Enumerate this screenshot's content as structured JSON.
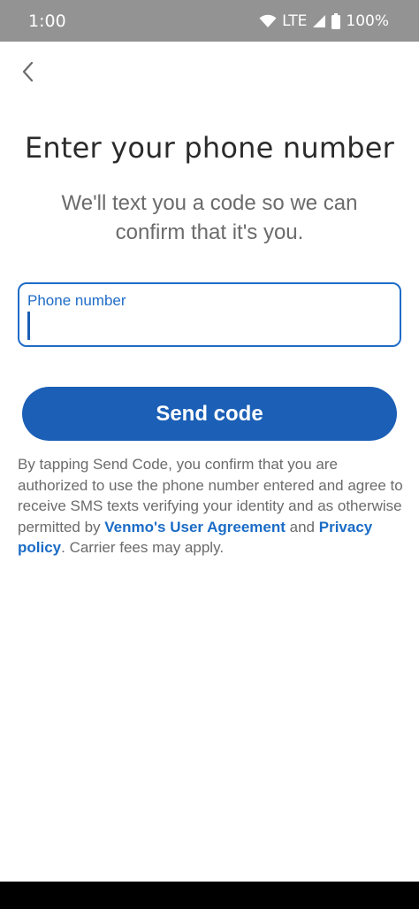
{
  "status_bar": {
    "time": "1:00",
    "network": "LTE",
    "battery": "100%",
    "icons": [
      "wifi-icon",
      "cell-signal-icon",
      "battery-icon"
    ]
  },
  "header": {
    "back_icon": "chevron-left-icon"
  },
  "main": {
    "title": "Enter your phone number",
    "subtitle": "We'll text you a code so we can confirm that it's you.",
    "phone_field": {
      "label": "Phone number",
      "value": ""
    },
    "send_button_label": "Send code",
    "legal": {
      "text_before": "By tapping Send Code, you confirm that you are authorized to use the phone number entered and agree to receive SMS texts verifying your identity and as otherwise permitted by ",
      "user_agreement_link": "Venmo's User Agreement",
      "text_middle": " and ",
      "privacy_link": "Privacy policy",
      "text_after": ". Carrier fees may apply."
    }
  },
  "colors": {
    "accent": "#1b5fb6",
    "link": "#1b6cc6",
    "status_bar": "#939393",
    "title_text": "#2b2b2b",
    "body_text": "#6b6b6b"
  }
}
